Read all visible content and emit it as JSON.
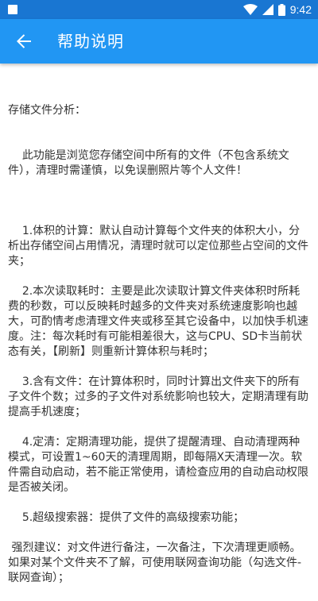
{
  "status_bar": {
    "time": "9:42",
    "icons": [
      "notification-square-icon",
      "wifi-icon",
      "signal-icon",
      "battery-icon"
    ]
  },
  "app_bar": {
    "back_icon": "arrow-back-icon",
    "title": "帮助说明"
  },
  "colors": {
    "status_bar": "#1976d2",
    "app_bar": "#2196f3",
    "text": "#333333"
  },
  "help": {
    "intro_heading": "存储文件分析：",
    "intro_body": "    此功能是浏览您存储空间中所有的文件（不包含系统文件），清理时需谨慎，以免误删照片等个人文件！",
    "p1": "    1.体积的计算：默认自动计算每个文件夹的体积大小，分析出存储空间占用情况，清理时就可以定位那些占空间的文件夹；",
    "p2": "    2.本次读取耗时：主要是此次读取计算文件夹体积时所耗费的秒数，可以反映耗时越多的文件夹对系统速度影响也越大，可酌情考虑清理文件夹或移至其它设备中，以加快手机速度。注：每次耗时有可能相差很大，这与CPU、SD卡当前状态有关，【刷新】则重新计算体积与耗时；",
    "p3": "    3.含有文件：在计算体积时，同时计算出文件夹下的所有子文件个数；过多的子文件对系统影响也较大，定期清理有助提高手机速度；",
    "p4": "    4.定清：定期清理功能，提供了提醒清理、自动清理两种模式，可设置1~60天的清理周期，即每隔X天清理一次。软件需自动启动，若不能正常使用，请检查应用的自动启动权限是否被关闭。",
    "p5": "    5.超级搜索器：提供了文件的高级搜索功能；",
    "p6": " 强烈建议：对文件进行备注，一次备注，下次清理更顺畅。如果对某个文件夹不了解，可使用联网查询功能（勾选文件-联网查询）；"
  }
}
